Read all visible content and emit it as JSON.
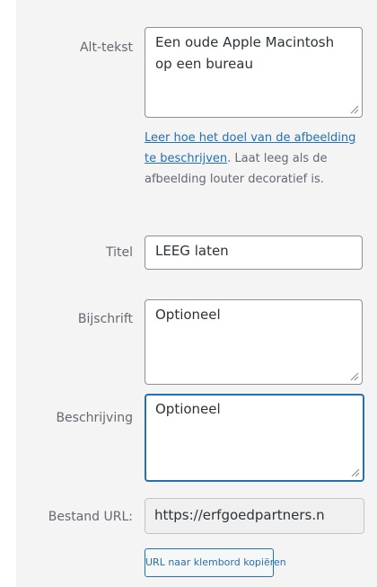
{
  "alt": {
    "label": "Alt-tekst",
    "value": "Een oude Apple Macintosh op een bureau",
    "help_link": "Leer hoe het doel van de afbeelding te beschrijven",
    "help_tail": ". Laat leeg als de afbeelding louter decoratief is."
  },
  "title": {
    "label": "Titel",
    "value": "LEEG laten"
  },
  "caption": {
    "label": "Bijschrift",
    "value": "Optioneel"
  },
  "description": {
    "label": "Beschrijving",
    "value": "Optioneel"
  },
  "file_url": {
    "label": "Bestand URL:",
    "value": "https://erfgoedpartners.n"
  },
  "copy_button": {
    "label": "URL naar klembord kopiëren"
  },
  "colors": {
    "focus_border": "#2271b1",
    "link": "#2271b1",
    "label_text": "#646970"
  },
  "icons": {
    "textarea_resize": "resize-grip-icon"
  }
}
